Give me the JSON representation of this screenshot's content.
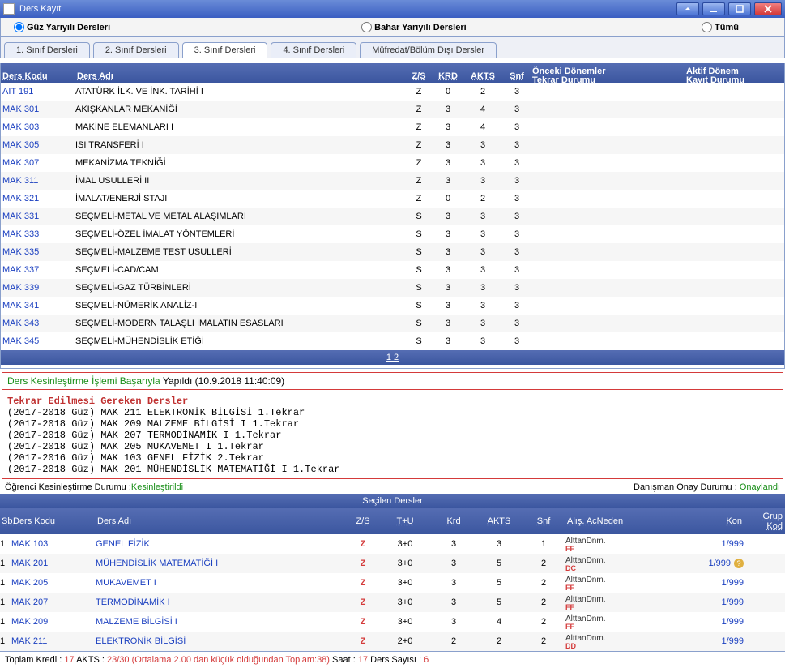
{
  "header": {
    "title": "Ders Kayıt"
  },
  "filters": {
    "guz": "Güz Yarıyılı Dersleri",
    "bahar": "Bahar Yarıyılı Dersleri",
    "tumu": "Tümü"
  },
  "tabs": [
    "1. Sınıf Dersleri",
    "2. Sınıf Dersleri",
    "3. Sınıf Dersleri",
    "4. Sınıf Dersleri",
    "Müfredat/Bölüm Dışı Dersler"
  ],
  "ct_headers": {
    "kodu": "Ders Kodu",
    "adi": "Ders Adı",
    "zs": "Z/S",
    "krd": "KRD",
    "akts": "AKTS",
    "snf": "Snf",
    "onceki": "Önceki Dönemler\nTekrar Durumu",
    "aktif": "Aktif Dönem\nKayıt Durumu"
  },
  "courses": [
    {
      "code": "AIT 191",
      "name": "ATATÜRK İLK. VE İNK. TARİHİ I",
      "zs": "Z",
      "krd": "0",
      "akts": "2",
      "snf": "3"
    },
    {
      "code": "MAK 301",
      "name": "AKIŞKANLAR MEKANİĞİ",
      "zs": "Z",
      "krd": "3",
      "akts": "4",
      "snf": "3"
    },
    {
      "code": "MAK 303",
      "name": "MAKİNE ELEMANLARI I",
      "zs": "Z",
      "krd": "3",
      "akts": "4",
      "snf": "3"
    },
    {
      "code": "MAK 305",
      "name": "ISI TRANSFERİ I",
      "zs": "Z",
      "krd": "3",
      "akts": "3",
      "snf": "3"
    },
    {
      "code": "MAK 307",
      "name": "MEKANİZMA TEKNİĞİ",
      "zs": "Z",
      "krd": "3",
      "akts": "3",
      "snf": "3"
    },
    {
      "code": "MAK 311",
      "name": "İMAL USULLERİ II",
      "zs": "Z",
      "krd": "3",
      "akts": "3",
      "snf": "3"
    },
    {
      "code": "MAK 321",
      "name": "İMALAT/ENERJİ STAJI",
      "zs": "Z",
      "krd": "0",
      "akts": "2",
      "snf": "3"
    },
    {
      "code": "MAK 331",
      "name": "SEÇMELİ-METAL VE METAL ALAŞIMLARI",
      "zs": "S",
      "krd": "3",
      "akts": "3",
      "snf": "3"
    },
    {
      "code": "MAK 333",
      "name": "SEÇMELİ-ÖZEL İMALAT YÖNTEMLERİ",
      "zs": "S",
      "krd": "3",
      "akts": "3",
      "snf": "3"
    },
    {
      "code": "MAK 335",
      "name": "SEÇMELİ-MALZEME TEST USULLERİ",
      "zs": "S",
      "krd": "3",
      "akts": "3",
      "snf": "3"
    },
    {
      "code": "MAK 337",
      "name": "SEÇMELİ-CAD/CAM",
      "zs": "S",
      "krd": "3",
      "akts": "3",
      "snf": "3"
    },
    {
      "code": "MAK 339",
      "name": "SEÇMELİ-GAZ TÜRBİNLERİ",
      "zs": "S",
      "krd": "3",
      "akts": "3",
      "snf": "3"
    },
    {
      "code": "MAK 341",
      "name": "SEÇMELİ-NÜMERİK ANALİZ-I",
      "zs": "S",
      "krd": "3",
      "akts": "3",
      "snf": "3"
    },
    {
      "code": "MAK 343",
      "name": "SEÇMELİ-MODERN TALAŞLI İMALATIN ESASLARI",
      "zs": "S",
      "krd": "3",
      "akts": "3",
      "snf": "3"
    },
    {
      "code": "MAK 345",
      "name": "SEÇMELİ-MÜHENDİSLİK ETİĞİ",
      "zs": "S",
      "krd": "3",
      "akts": "3",
      "snf": "3"
    }
  ],
  "pager": "1 2",
  "message": {
    "green1": "Ders Kesinleştirme İşlemi Başarıyla ",
    "black": "Yapıldı (10.9.2018 11:40:09)"
  },
  "repeat": {
    "title": "Tekrar Edilmesi Gereken Dersler",
    "lines": [
      "(2017-2018 Güz) MAK 211 ELEKTRONİK BİLGİSİ 1.Tekrar",
      "(2017-2018 Güz) MAK 209 MALZEME BİLGİSİ I 1.Tekrar",
      "(2017-2018 Güz) MAK 207 TERMODİNAMİK I 1.Tekrar",
      "(2017-2018 Güz) MAK 205 MUKAVEMET I 1.Tekrar",
      "(2017-2016 Güz) MAK 103 GENEL FİZİK 2.Tekrar",
      "(2017-2018 Güz) MAK 201 MÜHENDİSLİK MATEMATİĞİ I 1.Tekrar"
    ]
  },
  "status": {
    "left_label": "Öğrenci Kesinleştirme Durumu : ",
    "left_val": "Kesinleştirildi",
    "right_label": "Danışman Onay Durumu : ",
    "right_val": "Onaylandı"
  },
  "sel_title": "Seçilen Dersler",
  "sel_headers": {
    "sb": "Sb.",
    "kodu": "Ders Kodu",
    "adi": "Ders Adı",
    "zs": "Z/S",
    "tu": "T+U",
    "krd": "Krd",
    "akts": "AKTS",
    "snf": "Snf",
    "alis": "Alış. AcNeden",
    "kon": "Kon",
    "grup": "Grup Kod"
  },
  "selected": [
    {
      "sb": "1",
      "code": "MAK 103",
      "name": "GENEL FİZİK",
      "zs": "Z",
      "tu": "3+0",
      "krd": "3",
      "akts": "3",
      "snf": "1",
      "alis": "Alttan",
      "dnm": "Dnm.",
      "grade": "FF",
      "kon": "1/999",
      "warn": false
    },
    {
      "sb": "1",
      "code": "MAK 201",
      "name": "MÜHENDİSLİK MATEMATİĞİ I",
      "zs": "Z",
      "tu": "3+0",
      "krd": "3",
      "akts": "5",
      "snf": "2",
      "alis": "Alttan",
      "dnm": "Dnm.",
      "grade": "DC",
      "kon": "1/999",
      "warn": true
    },
    {
      "sb": "1",
      "code": "MAK 205",
      "name": "MUKAVEMET I",
      "zs": "Z",
      "tu": "3+0",
      "krd": "3",
      "akts": "5",
      "snf": "2",
      "alis": "Alttan",
      "dnm": "Dnm.",
      "grade": "FF",
      "kon": "1/999",
      "warn": false
    },
    {
      "sb": "1",
      "code": "MAK 207",
      "name": "TERMODİNAMİK I",
      "zs": "Z",
      "tu": "3+0",
      "krd": "3",
      "akts": "5",
      "snf": "2",
      "alis": "Alttan",
      "dnm": "Dnm.",
      "grade": "FF",
      "kon": "1/999",
      "warn": false
    },
    {
      "sb": "1",
      "code": "MAK 209",
      "name": "MALZEME BİLGİSİ I",
      "zs": "Z",
      "tu": "3+0",
      "krd": "3",
      "akts": "4",
      "snf": "2",
      "alis": "Alttan",
      "dnm": "Dnm.",
      "grade": "FF",
      "kon": "1/999",
      "warn": false
    },
    {
      "sb": "1",
      "code": "MAK 211",
      "name": "ELEKTRONİK BİLGİSİ",
      "zs": "Z",
      "tu": "2+0",
      "krd": "2",
      "akts": "2",
      "snf": "2",
      "alis": "Alttan",
      "dnm": "Dnm.",
      "grade": "DD",
      "kon": "1/999",
      "warn": false
    }
  ],
  "footer": {
    "lbl_kredi": "Toplam Kredi : ",
    "kredi": "17",
    "lbl_akts": " AKTS : ",
    "akts": "23/30 (Ortalama 2.00 dan küçük olduğundan Toplam:38)",
    "lbl_saat": " Saat : ",
    "saat": "17",
    "lbl_count": " Ders Sayısı : ",
    "count": "6"
  }
}
